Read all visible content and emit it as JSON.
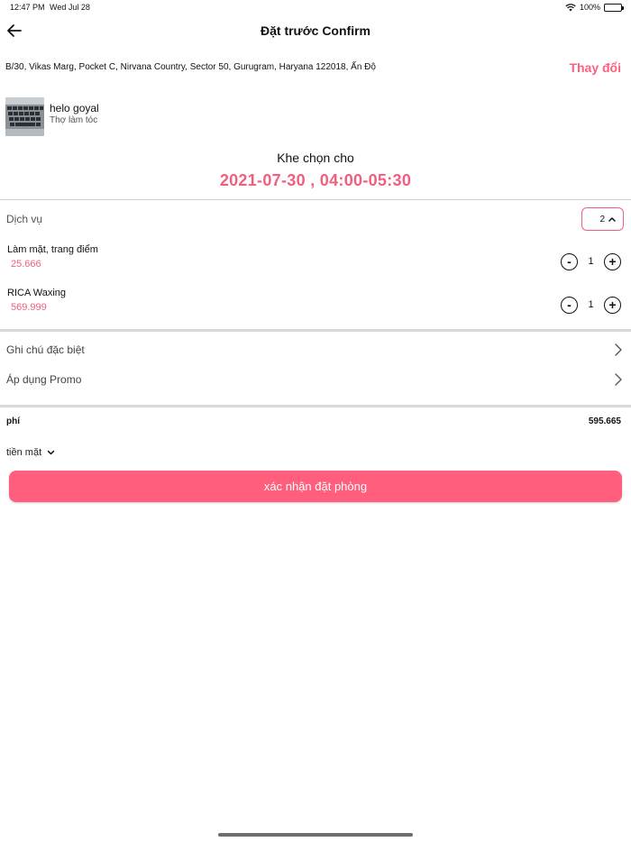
{
  "status_bar": {
    "time": "12:47 PM",
    "date": "Wed Jul 28",
    "battery": "100%"
  },
  "nav": {
    "title": "Đặt trước Confirm"
  },
  "address": {
    "text": "B/30, Vikas Marg, Pocket C, Nirvana Country, Sector 50, Gurugram, Haryana 122018, Ấn Độ",
    "change_label": "Thay đổi"
  },
  "provider": {
    "name": "helo goyal",
    "role": "Thợ làm tóc"
  },
  "slot": {
    "label": "Khe chọn cho",
    "value": "2021-07-30 , 04:00-05:30"
  },
  "services": {
    "label": "Dịch vụ",
    "count": "2",
    "items": [
      {
        "name": "Làm mặt, trang điểm",
        "price": "25.666",
        "qty": "1",
        "minus": "-",
        "plus": "+"
      },
      {
        "name": "RICA Waxing",
        "price": "569.999",
        "qty": "1",
        "minus": "-",
        "plus": "+"
      }
    ]
  },
  "options": {
    "special_note": "Ghi chú đặc biệt",
    "promo": "Áp dụng Promo"
  },
  "fee": {
    "label": "phí",
    "value": "595.665"
  },
  "payment": {
    "method": "tiền mặt"
  },
  "confirm": {
    "label": "xác nhận đặt phòng"
  },
  "colors": {
    "accent": "#f25f7e",
    "button": "#ff5e7c"
  }
}
